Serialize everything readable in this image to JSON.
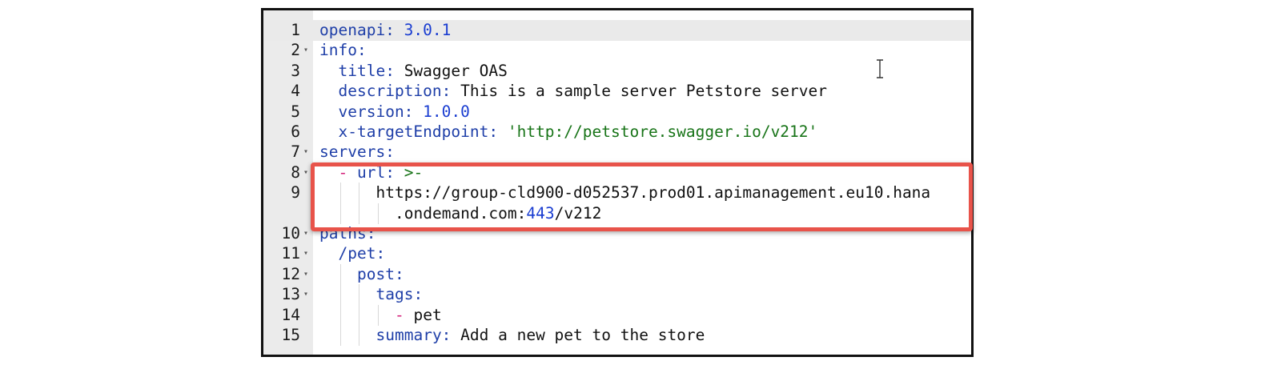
{
  "editor": {
    "lines": [
      {
        "num": "1",
        "fold": false,
        "indent": 0,
        "parts": [
          [
            "key",
            "openapi:"
          ],
          [
            "plain",
            " "
          ],
          [
            "num",
            "3.0.1"
          ]
        ]
      },
      {
        "num": "2",
        "fold": true,
        "indent": 0,
        "parts": [
          [
            "key",
            "info:"
          ]
        ]
      },
      {
        "num": "3",
        "fold": false,
        "indent": 1,
        "parts": [
          [
            "key",
            "title:"
          ],
          [
            "plain",
            " Swagger OAS"
          ]
        ]
      },
      {
        "num": "4",
        "fold": false,
        "indent": 1,
        "parts": [
          [
            "key",
            "description:"
          ],
          [
            "plain",
            " This is a sample server Petstore server"
          ]
        ]
      },
      {
        "num": "5",
        "fold": false,
        "indent": 1,
        "parts": [
          [
            "key",
            "version:"
          ],
          [
            "plain",
            " "
          ],
          [
            "num",
            "1.0.0"
          ]
        ]
      },
      {
        "num": "6",
        "fold": false,
        "indent": 1,
        "parts": [
          [
            "key",
            "x-targetEndpoint:"
          ],
          [
            "plain",
            " "
          ],
          [
            "str",
            "'http://petstore.swagger.io/v212'"
          ]
        ]
      },
      {
        "num": "7",
        "fold": true,
        "indent": 0,
        "parts": [
          [
            "key",
            "servers:"
          ]
        ]
      },
      {
        "num": "8",
        "fold": true,
        "indent": 1,
        "parts": [
          [
            "dash",
            "- "
          ],
          [
            "key",
            "url:"
          ],
          [
            "plain",
            " "
          ],
          [
            "sym",
            ">-"
          ]
        ]
      },
      {
        "num": "9",
        "fold": false,
        "indent": 3,
        "parts": [
          [
            "plain",
            "https://group-cld900-d052537.prod01.apimanagement.eu10.hana"
          ]
        ]
      },
      {
        "num": "",
        "fold": false,
        "indent": 4,
        "parts": [
          [
            "plain",
            ".ondemand.com:"
          ],
          [
            "num",
            "443"
          ],
          [
            "plain",
            "/v212"
          ]
        ]
      },
      {
        "num": "10",
        "fold": true,
        "indent": 0,
        "parts": [
          [
            "key",
            "paths:"
          ]
        ]
      },
      {
        "num": "11",
        "fold": true,
        "indent": 1,
        "parts": [
          [
            "key",
            "/pet:"
          ]
        ]
      },
      {
        "num": "12",
        "fold": true,
        "indent": 2,
        "parts": [
          [
            "key",
            "post:"
          ]
        ]
      },
      {
        "num": "13",
        "fold": true,
        "indent": 3,
        "parts": [
          [
            "key",
            "tags:"
          ]
        ]
      },
      {
        "num": "14",
        "fold": false,
        "indent": 4,
        "parts": [
          [
            "dash",
            "- "
          ],
          [
            "plain",
            "pet"
          ]
        ]
      },
      {
        "num": "15",
        "fold": false,
        "indent": 3,
        "parts": [
          [
            "key",
            "summary:"
          ],
          [
            "plain",
            " Add a new pet to the store"
          ]
        ]
      }
    ],
    "active_line": "1",
    "fold_glyph": "▾",
    "highlighted_lines": [
      "8",
      "9"
    ]
  },
  "colors": {
    "key": "#1f3fa8",
    "number": "#1a3dd1",
    "string": "#187418",
    "dash": "#d4237b",
    "highlight_border": "#e8534a"
  }
}
